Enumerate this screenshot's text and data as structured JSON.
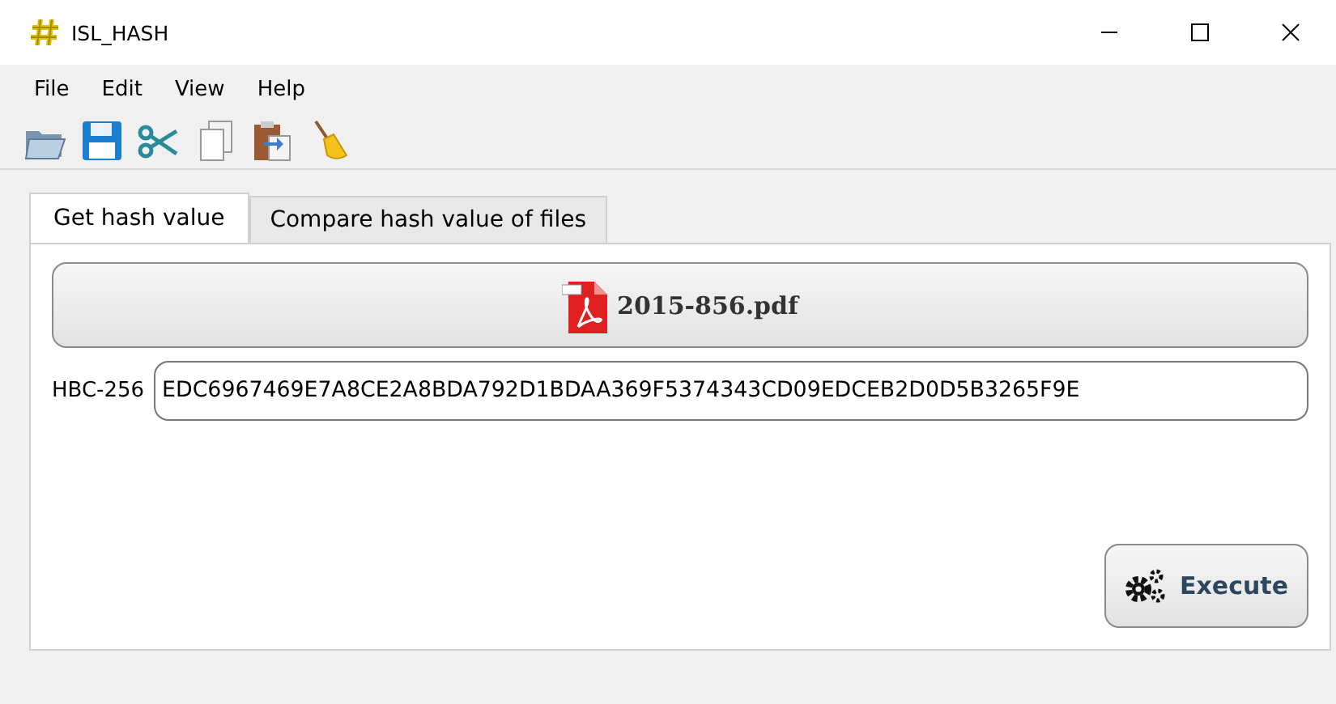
{
  "window": {
    "title": "ISL_HASH"
  },
  "menu": [
    "File",
    "Edit",
    "View",
    "Help"
  ],
  "toolbar": [
    {
      "kind": "open"
    },
    {
      "kind": "save"
    },
    {
      "kind": "cut"
    },
    {
      "kind": "copy"
    },
    {
      "kind": "paste"
    },
    {
      "kind": "clear"
    }
  ],
  "tabs": [
    {
      "label": "Get hash value",
      "selected": true
    },
    {
      "label": "Compare hash value of files",
      "selected": false
    }
  ],
  "file_button": {
    "label": "2015-856.pdf"
  },
  "hash": {
    "label": "HBC-256",
    "value": "EDC6967469E7A8CE2A8BDA792D1BDAA369F5374343CD09EDCEB2D0D5B3265F9E"
  },
  "execute_button": {
    "label": "Execute"
  }
}
